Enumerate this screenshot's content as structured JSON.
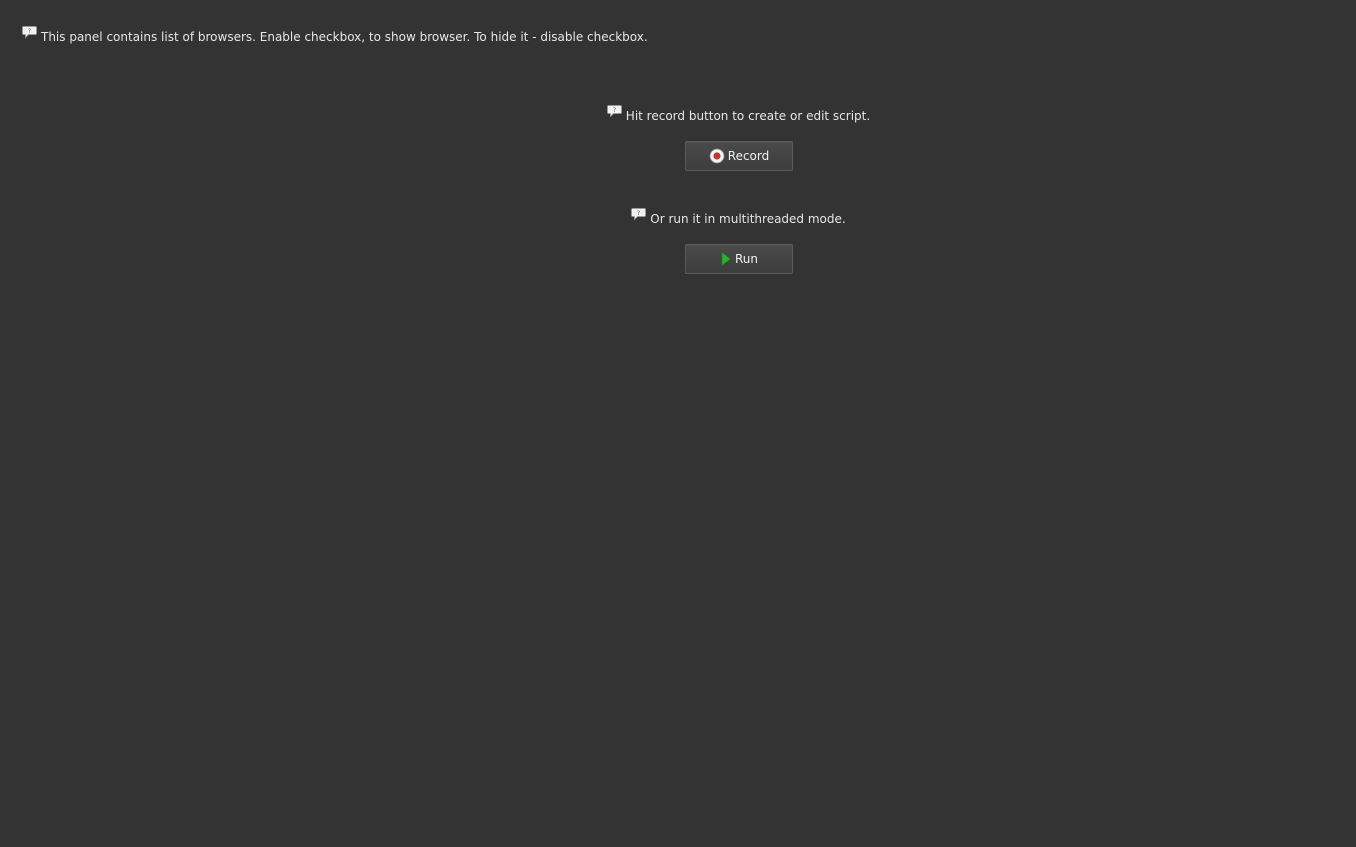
{
  "hints": {
    "panel": "This panel contains list of browsers. Enable checkbox, to show browser. To hide it - disable checkbox.",
    "record": "Hit record button to create or edit script.",
    "run": "Or run it in multithreaded mode."
  },
  "buttons": {
    "record_label": "Record",
    "run_label": "Run"
  },
  "icons": {
    "hint": "help-bubble-icon",
    "record": "record-icon",
    "run": "play-icon"
  },
  "colors": {
    "background": "#333333",
    "record_dot": "#c0392b",
    "run_play": "#2db12d"
  }
}
